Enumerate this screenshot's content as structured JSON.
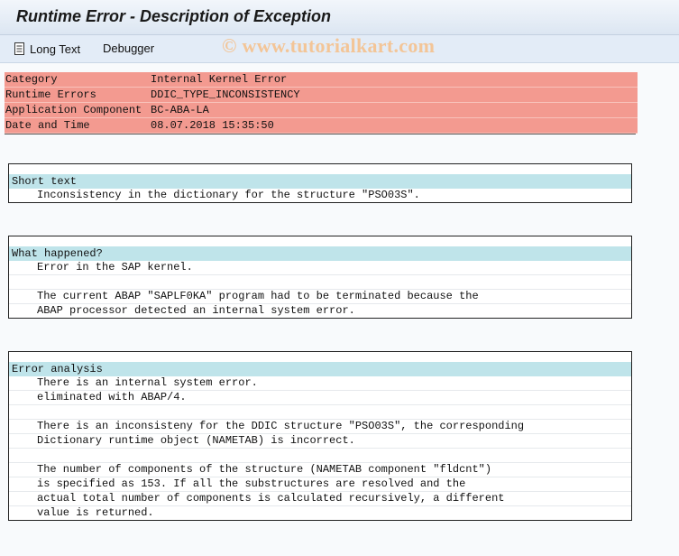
{
  "window": {
    "title": "Runtime Error - Description of Exception"
  },
  "toolbar": {
    "long_text_label": "Long Text",
    "debugger_label": "Debugger",
    "long_text_icon": "document-icon"
  },
  "watermark": "© www.tutorialkart.com",
  "header": {
    "rows": [
      {
        "label": "Category",
        "value": "Internal Kernel Error"
      },
      {
        "label": "Runtime Errors",
        "value": "DDIC_TYPE_INCONSISTENCY"
      },
      {
        "label": "Application Component",
        "value": "BC-ABA-LA"
      },
      {
        "label": "Date and Time",
        "value": "08.07.2018 15:35:50"
      }
    ],
    "background_color": "#f39a90"
  },
  "sections": {
    "short_text": {
      "title": "Short text",
      "lines": [
        "Inconsistency in the dictionary for the structure \"PSO03S\"."
      ]
    },
    "what_happened": {
      "title": "What happened?",
      "lines": [
        "Error in the SAP kernel.",
        "",
        "The current ABAP \"SAPLF0KA\" program had to be terminated because the",
        "ABAP processor detected an internal system error."
      ]
    },
    "error_analysis": {
      "title": "Error analysis",
      "lines": [
        "There is an internal system error.",
        "eliminated with ABAP/4.",
        "",
        "There is an inconsisteny for the DDIC structure \"PSO03S\", the corresponding",
        "Dictionary runtime object (NAMETAB) is incorrect.",
        "",
        "The number of components of the structure (NAMETAB component \"fldcnt\")",
        "is specified as 153. If all the substructures are resolved and the",
        "actual total number of components is calculated recursively, a different",
        "value is returned."
      ]
    },
    "head_color": "#bfe4ea"
  }
}
